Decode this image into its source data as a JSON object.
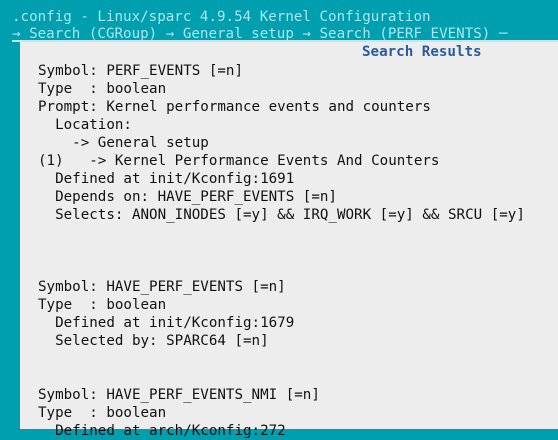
{
  "window": {
    "title": ".config - Linux/sparc 4.9.54 Kernel Configuration",
    "breadcrumb": "→ Search (CGRoup) → General setup → Search (PERF_EVENTS) ─"
  },
  "panel": {
    "title": "Search Results"
  },
  "results": [
    {
      "lines": [
        "Symbol: PERF_EVENTS [=n]",
        "Type  : boolean",
        "Prompt: Kernel performance events and counters",
        "  Location:",
        "    -> General setup",
        "(1)   -> Kernel Performance Events And Counters",
        "  Defined at init/Kconfig:1691",
        "  Depends on: HAVE_PERF_EVENTS [=n]",
        "  Selects: ANON_INODES [=y] && IRQ_WORK [=y] && SRCU [=y]"
      ]
    },
    {
      "lines": [
        "Symbol: HAVE_PERF_EVENTS [=n]",
        "Type  : boolean",
        "  Defined at init/Kconfig:1679",
        "  Selected by: SPARC64 [=n]"
      ]
    },
    {
      "lines": [
        "Symbol: HAVE_PERF_EVENTS_NMI [=n]",
        "Type  : boolean",
        "  Defined at arch/Kconfig:272"
      ]
    }
  ],
  "colors": {
    "background": "#009faf",
    "panel": "#ededed",
    "title_text": "#a9e6ee",
    "panel_title": "#2a5aa0",
    "body_text": "#111111"
  }
}
